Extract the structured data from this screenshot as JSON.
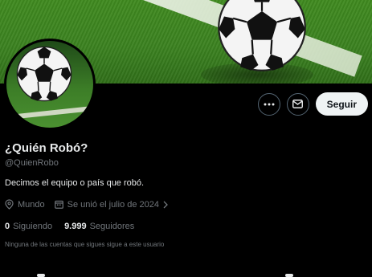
{
  "profile": {
    "name": "¿Quién Robó?",
    "handle": "@QuienRobo",
    "bio": "Decimos el equipo o país que robó.",
    "location": "Mundo",
    "joined": "Se unió el julio de 2024",
    "following_count": "0",
    "following_label": "Siguiendo",
    "followers_count": "9.999",
    "followers_label": "Seguidores",
    "followers_note": "Ninguna de las cuentas que sigues sigue a este usuario"
  },
  "actions": {
    "more_icon": "more-icon",
    "message_icon": "envelope-icon",
    "follow_label": "Seguir"
  },
  "icons": {
    "location": "location-pin-icon",
    "calendar": "calendar-icon",
    "chevron": "chevron-right-icon"
  },
  "colors": {
    "background": "#000000",
    "primary_text": "#e7e9ea",
    "secondary_text": "#71767b",
    "button_bg": "#eff3f4",
    "button_text": "#0f1419",
    "border": "#536471"
  }
}
